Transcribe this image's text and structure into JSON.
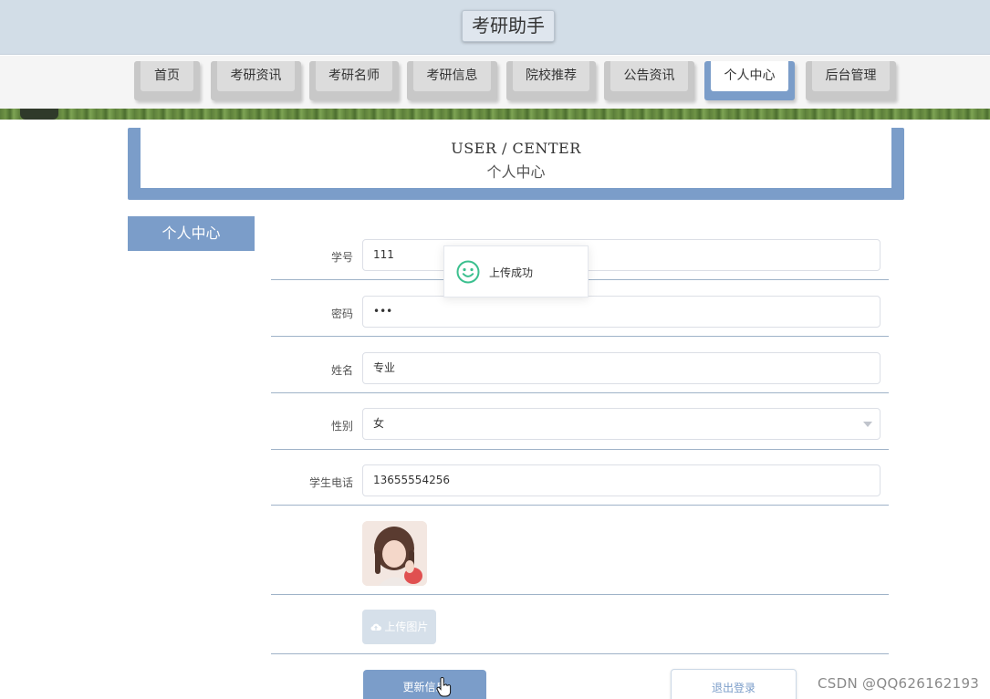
{
  "header": {
    "title": "考研助手"
  },
  "nav": {
    "items": [
      {
        "label": "首页",
        "active": false
      },
      {
        "label": "考研资讯",
        "active": false
      },
      {
        "label": "考研名师",
        "active": false
      },
      {
        "label": "考研信息",
        "active": false
      },
      {
        "label": "院校推荐",
        "active": false
      },
      {
        "label": "公告资讯",
        "active": false
      },
      {
        "label": "个人中心",
        "active": true
      },
      {
        "label": "后台管理",
        "active": false
      }
    ]
  },
  "banner": {
    "title_en": "USER / CENTER",
    "title_cn": "个人中心"
  },
  "sidebar": {
    "title": "个人中心"
  },
  "form": {
    "student_id": {
      "label": "学号",
      "value": "111"
    },
    "password": {
      "label": "密码",
      "value": "•••"
    },
    "name": {
      "label": "姓名",
      "value": "专业"
    },
    "gender": {
      "label": "性别",
      "value": "女"
    },
    "phone": {
      "label": "学生电话",
      "value": "13655554256"
    },
    "upload_label": "上传图片",
    "update_label": "更新信息",
    "logout_label": "退出登录"
  },
  "toast": {
    "message": "上传成功",
    "icon": "smile-icon"
  },
  "watermark": "CSDN @QQ626162193",
  "colors": {
    "accent": "#7b9dc9",
    "header_bg": "#d2dde7",
    "success": "#3cc08f"
  }
}
